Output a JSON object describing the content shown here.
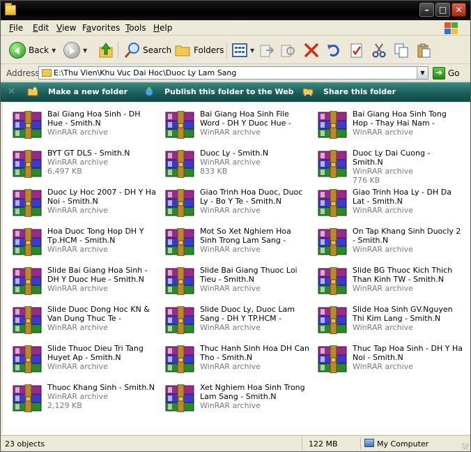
{
  "window": {
    "title": ""
  },
  "menu": {
    "items": [
      {
        "key": "F",
        "rest": "ile"
      },
      {
        "key": "E",
        "rest": "dit"
      },
      {
        "key": "V",
        "rest": "iew"
      },
      {
        "key": "F",
        "rest": "avorites",
        "pre": "",
        "full": "Favorites"
      },
      {
        "key": "T",
        "rest": "ools"
      },
      {
        "key": "H",
        "rest": "elp"
      }
    ]
  },
  "toolbar": {
    "back_label": "Back",
    "search_label": "Search",
    "folders_label": "Folders"
  },
  "address": {
    "label": "Address",
    "path": "E:\\Thu Vien\\Khu Vuc Dai Hoc\\Duoc Ly Lam Sang",
    "go_label": "Go"
  },
  "tasks": {
    "make_folder": "Make a new folder",
    "publish": "Publish this folder to the Web",
    "share": "Share this folder"
  },
  "files": [
    {
      "name": "Bai Giang Hoa Sinh - DH Hue - Smith.N",
      "type": "WinRAR archive",
      "size": ""
    },
    {
      "name": "Bai Giang Hoa Sinh File Word - DH Y Duoc Hue - Smith.N",
      "type": "WinRAR archive",
      "size": ""
    },
    {
      "name": "Bai Giang Hoa Sinh Tong Hop - Thay Hai Nam - Smith.N",
      "type": "WinRAR archive",
      "size": ""
    },
    {
      "name": "BYT GT DLS - Smith.N",
      "type": "WinRAR archive",
      "size": "6,497 KB"
    },
    {
      "name": "Duoc Ly - Smith.N",
      "type": "WinRAR archive",
      "size": "833 KB"
    },
    {
      "name": "Duoc Ly Dai Cuong - Smith.N",
      "type": "WinRAR archive",
      "size": "776 KB"
    },
    {
      "name": "Duoc Ly Hoc 2007 - DH Y Ha Noi - Smith.N",
      "type": "WinRAR archive",
      "size": ""
    },
    {
      "name": "Giao Trinh Hoa Duoc, Duoc Ly - Bo Y Te - Smith.N",
      "type": "WinRAR archive",
      "size": ""
    },
    {
      "name": "Giao Trinh Hoa Ly - DH Da Lat - Smith.N",
      "type": "WinRAR archive",
      "size": ""
    },
    {
      "name": "Hoa Duoc Tong Hop DH Y Tp.HCM - Smith.N",
      "type": "WinRAR archive",
      "size": ""
    },
    {
      "name": "Mot So Xet Nghiem Hoa Sinh Trong Lam Sang - Ts.Phan ...",
      "type": "WinRAR archive",
      "size": ""
    },
    {
      "name": "On Tap Khang Sinh Duocly 2  - Smith.N",
      "type": "WinRAR archive",
      "size": ""
    },
    {
      "name": "Slide Bai Giang Hoa Sinh - DH Y Duoc Hue - Smith.N",
      "type": "WinRAR archive",
      "size": ""
    },
    {
      "name": "Slide Bai Giang Thuoc Loi Tieu - Smith.N",
      "type": "WinRAR archive",
      "size": ""
    },
    {
      "name": "Slide BG Thuoc Kich Thich Than Kinh TW - Smith.N",
      "type": "WinRAR archive",
      "size": ""
    },
    {
      "name": "Slide Duoc Dong Hoc KN & Van Dung Thuc Te - DS.Nguyen ...",
      "type": "WinRAR archive",
      "size": ""
    },
    {
      "name": "Slide Duoc Ly, Duoc Lam Sang - DH Y TP.HCM - Smith.N",
      "type": "WinRAR archive",
      "size": ""
    },
    {
      "name": "Slide Hoa Sinh GV.Nguyen Thi Kim Lang - Smith.N",
      "type": "WinRAR archive",
      "size": ""
    },
    {
      "name": "Slide Thuoc Dieu Tri Tang Huyet Ap - Smith.N",
      "type": "WinRAR archive",
      "size": ""
    },
    {
      "name": "Thuc Hanh Sinh Hoa DH Can Tho - Smith.N",
      "type": "WinRAR archive",
      "size": ""
    },
    {
      "name": "Thuc Tap Hoa Sinh - DH Y Ha Noi - Smith.N",
      "type": "WinRAR archive",
      "size": ""
    },
    {
      "name": "Thuoc Khang Sinh - Smith.N",
      "type": "WinRAR archive",
      "size": "2,129 KB"
    },
    {
      "name": "Xet Nghiem Hoa Sinh Trong Lam Sang - Smith.N",
      "type": "WinRAR archive",
      "size": ""
    }
  ],
  "status": {
    "count": "23 objects",
    "size": "122 MB",
    "location": "My Computer"
  }
}
